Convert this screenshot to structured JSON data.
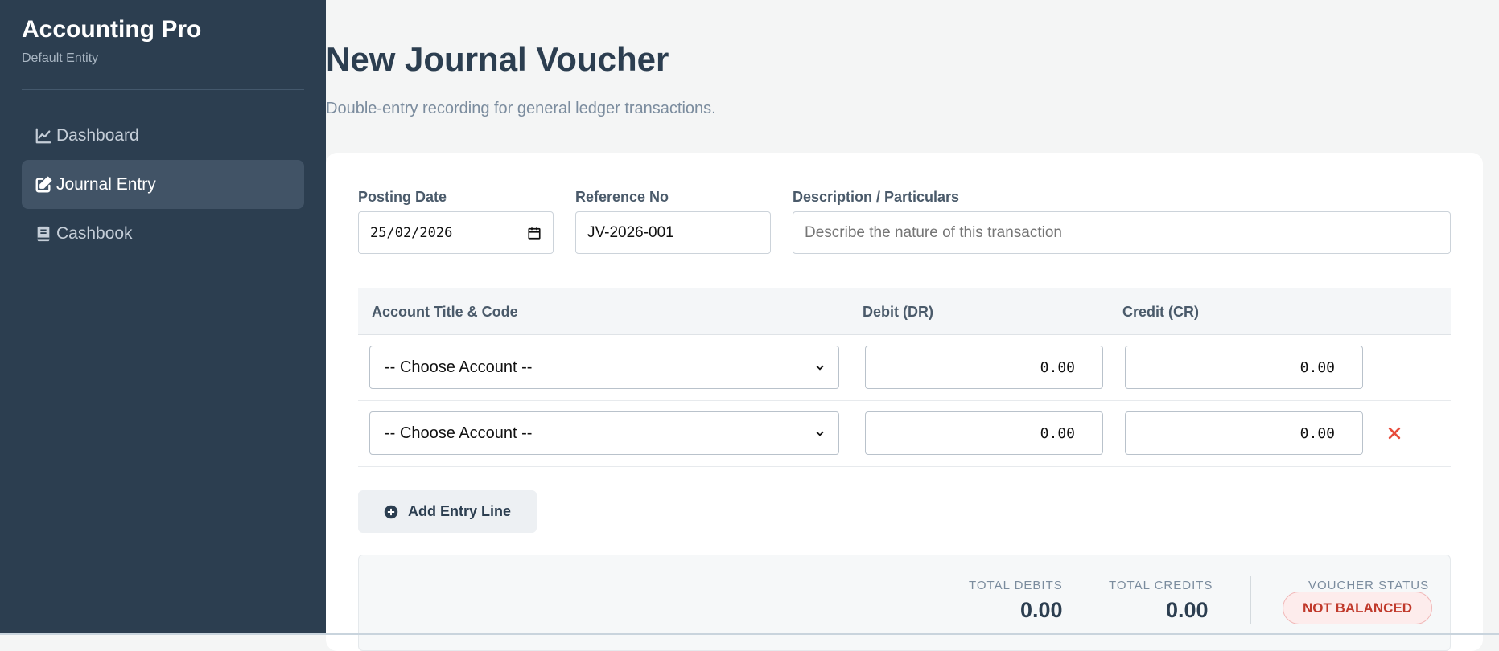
{
  "sidebar": {
    "brand_title": "Accounting Pro",
    "brand_subtitle": "Default Entity",
    "items": [
      {
        "label": "Dashboard",
        "icon": "chart-line-icon",
        "active": false
      },
      {
        "label": "Journal Entry",
        "icon": "edit-icon",
        "active": true
      },
      {
        "label": "Cashbook",
        "icon": "book-icon",
        "active": false
      }
    ]
  },
  "page": {
    "title": "New Journal Voucher",
    "subtitle": "Double-entry recording for general ledger transactions."
  },
  "form": {
    "posting_date_label": "Posting Date",
    "posting_date_value": "25/02/2026",
    "reference_label": "Reference No",
    "reference_value": "JV-2026-001",
    "description_label": "Description / Particulars",
    "description_placeholder": "Describe the nature of this transaction"
  },
  "table": {
    "headers": {
      "account": "Account Title & Code",
      "debit": "Debit (DR)",
      "credit": "Credit (CR)"
    },
    "rows": [
      {
        "account": "-- Choose Account --",
        "debit": "0.00",
        "credit": "0.00",
        "removable": false
      },
      {
        "account": "-- Choose Account --",
        "debit": "0.00",
        "credit": "0.00",
        "removable": true
      }
    ]
  },
  "add_line_label": "Add Entry Line",
  "totals": {
    "debits_label": "TOTAL DEBITS",
    "debits_value": "0.00",
    "credits_label": "TOTAL CREDITS",
    "credits_value": "0.00",
    "status_label": "VOUCHER STATUS",
    "status_value": "NOT BALANCED"
  },
  "colors": {
    "sidebar_bg": "#2c3e50",
    "active_item_bg": "#415366",
    "danger": "#c0392b"
  }
}
